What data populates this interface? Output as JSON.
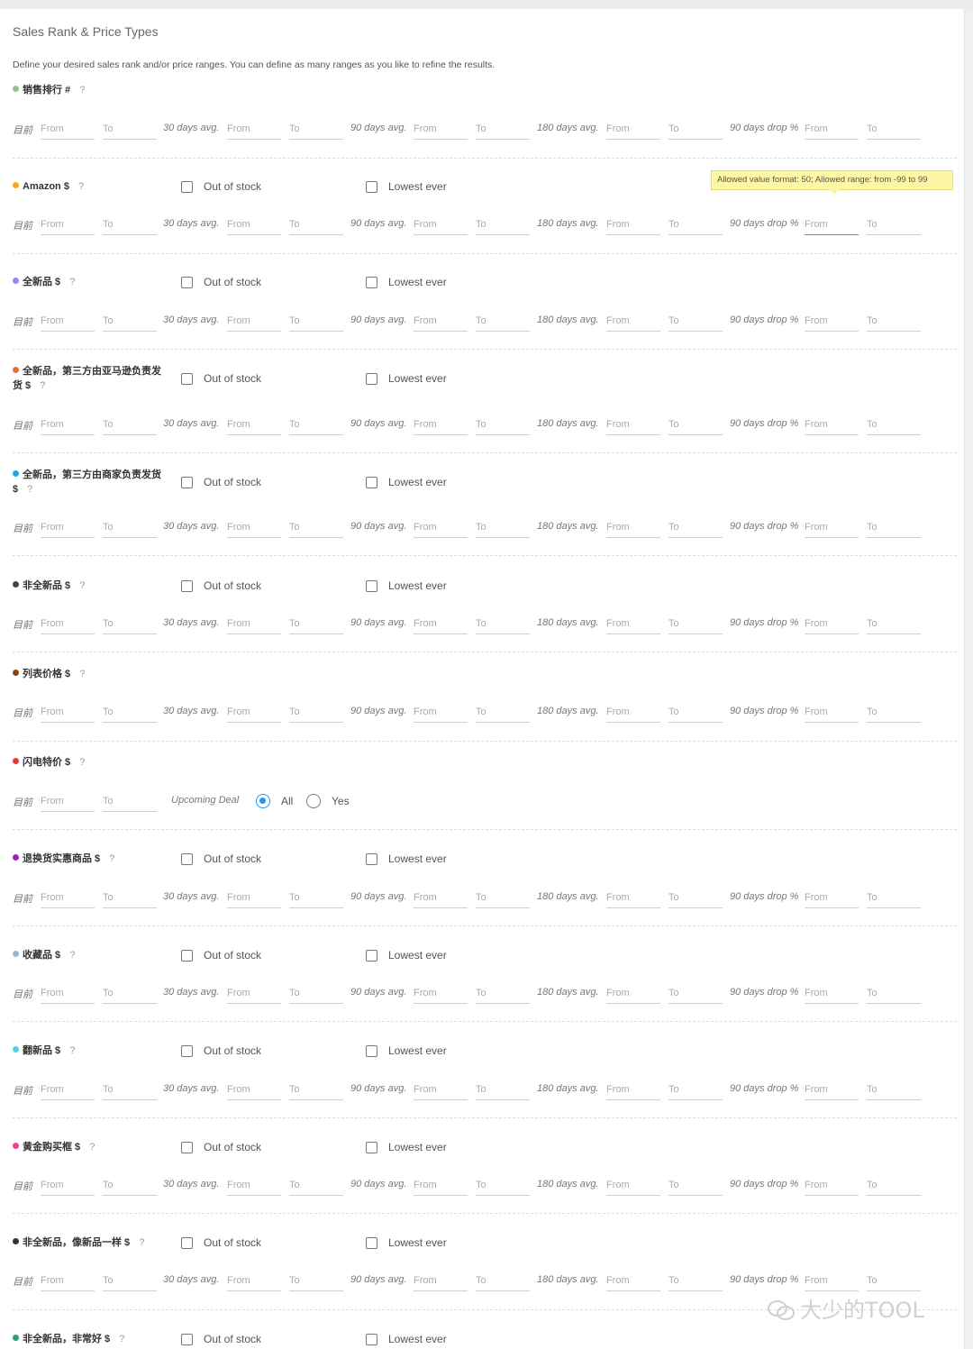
{
  "title": "Sales Rank & Price Types",
  "description": "Define your desired sales rank and/or price ranges. You can define as many ranges as you like to refine the results.",
  "tooltip": "Allowed value format: 50; Allowed range: from -99 to 99",
  "labels": {
    "current": "目前",
    "d30": "30 days avg.",
    "d90": "90 days avg.",
    "d180": "180 days avg.",
    "drop": "90 days drop %",
    "from": "From",
    "to": "To",
    "out_of_stock": "Out of stock",
    "lowest_ever": "Lowest ever",
    "help": "?",
    "upcoming_deal": "Upcoming Deal",
    "all": "All",
    "yes": "Yes"
  },
  "sections": [
    {
      "title": "销售排行 #",
      "color": "#8bc49a",
      "checks": false
    },
    {
      "title": "Amazon $",
      "color": "#f5a623",
      "checks": true
    },
    {
      "title": "全新品 $",
      "color": "#8e8cf0",
      "checks": true
    },
    {
      "title": "全新品，第三方由亚马逊负责发",
      "title2": "货 $",
      "color": "#f06a3a",
      "checks": true
    },
    {
      "title": "全新品，第三方由商家负责发货",
      "title2": "$",
      "color": "#2aa3e0",
      "checks": true
    },
    {
      "title": "非全新品 $",
      "color": "#444444",
      "checks": true
    },
    {
      "title": "列表价格 $",
      "color": "#8b4513",
      "checks": false
    },
    {
      "title": "闪电特价 $",
      "color": "#e53935",
      "checks": false,
      "deal": true
    },
    {
      "title": "退换货实惠商品 $",
      "color": "#9c27b0",
      "checks": true
    },
    {
      "title": "收藏品 $",
      "color": "#9db7cc",
      "checks": true
    },
    {
      "title": "翻新品 $",
      "color": "#5ad0e8",
      "checks": true
    },
    {
      "title": "黄金购买框 $",
      "color": "#e84393",
      "checks": true
    },
    {
      "title": "非全新品，像新品一样 $",
      "color": "#333333",
      "checks": true
    },
    {
      "title": "非全新品，非常好 $",
      "color": "#2e9e6a",
      "checks": true
    }
  ],
  "deal": {
    "selected": "All"
  },
  "watermark": "大少的TOOL",
  "colors": {
    "accent": "#2196f3",
    "tooltip_bg": "#fdf6a5"
  }
}
